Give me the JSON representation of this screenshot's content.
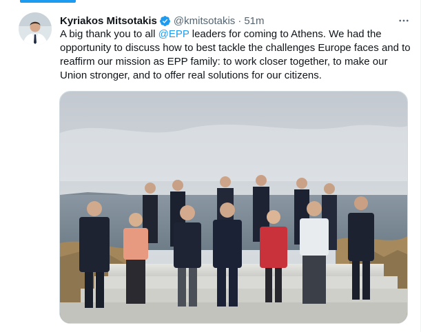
{
  "tweet": {
    "author_name": "Kyriakos Mitsotakis",
    "handle": "@kmitsotakis",
    "separator": "·",
    "time": "51m",
    "more_icon": "more-horizontal-icon",
    "verified_icon": "verified-badge-icon",
    "text_before": "A big thank you to all ",
    "mention": "@EPP",
    "text_after": " leaders for coming to Athens. We had the opportunity to discuss how to best tackle the challenges Europe faces and to reaffirm our mission as EPP family: to work closer together, to make our Union stronger, and to offer real solutions for our citizens.",
    "media_alt": "Group photo of EPP leaders",
    "colors": {
      "accent": "#1d9bf0",
      "text": "#0f1419",
      "muted": "#536471",
      "border": "#cfd9de"
    }
  }
}
